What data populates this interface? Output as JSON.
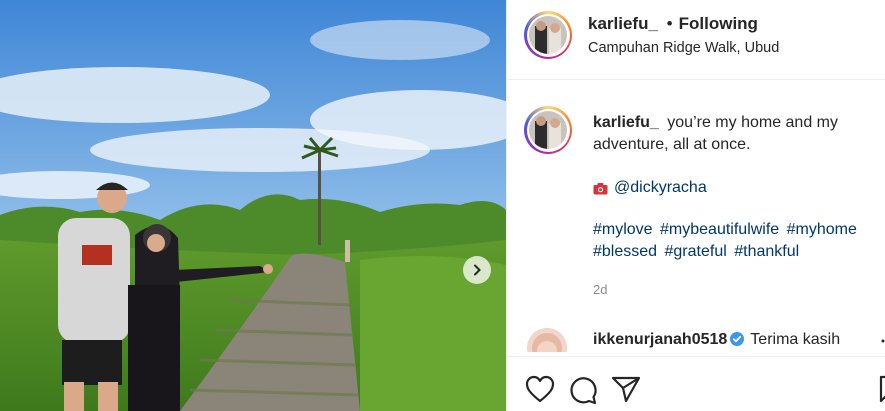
{
  "post": {
    "username": "karliefu_",
    "follow_separator": "•",
    "follow_status": "Following",
    "location": "Campuhan Ridge Walk, Ubud"
  },
  "caption": {
    "username": "karliefu_",
    "text": "you’re my home and my adventure, all at once.",
    "tagged_user": "@dickyracha",
    "hashtags": [
      "#mylove",
      "#mybeautifulwife",
      "#myhome",
      "#blessed",
      "#grateful",
      "#thankful"
    ],
    "time": "2d"
  },
  "comment": {
    "username": "ikkenurjanah0518",
    "text": "Terima kasih"
  },
  "icons": {
    "next": "chevron-right-icon",
    "like": "heart-icon",
    "comment": "comment-icon",
    "share": "paper-plane-icon",
    "save": "bookmark-icon",
    "tag": "camera-icon",
    "verified": "verified-badge-icon"
  },
  "colors": {
    "link": "#00376b",
    "verified": "#3897f0",
    "muted": "#8e8e8e",
    "text": "#262626"
  }
}
